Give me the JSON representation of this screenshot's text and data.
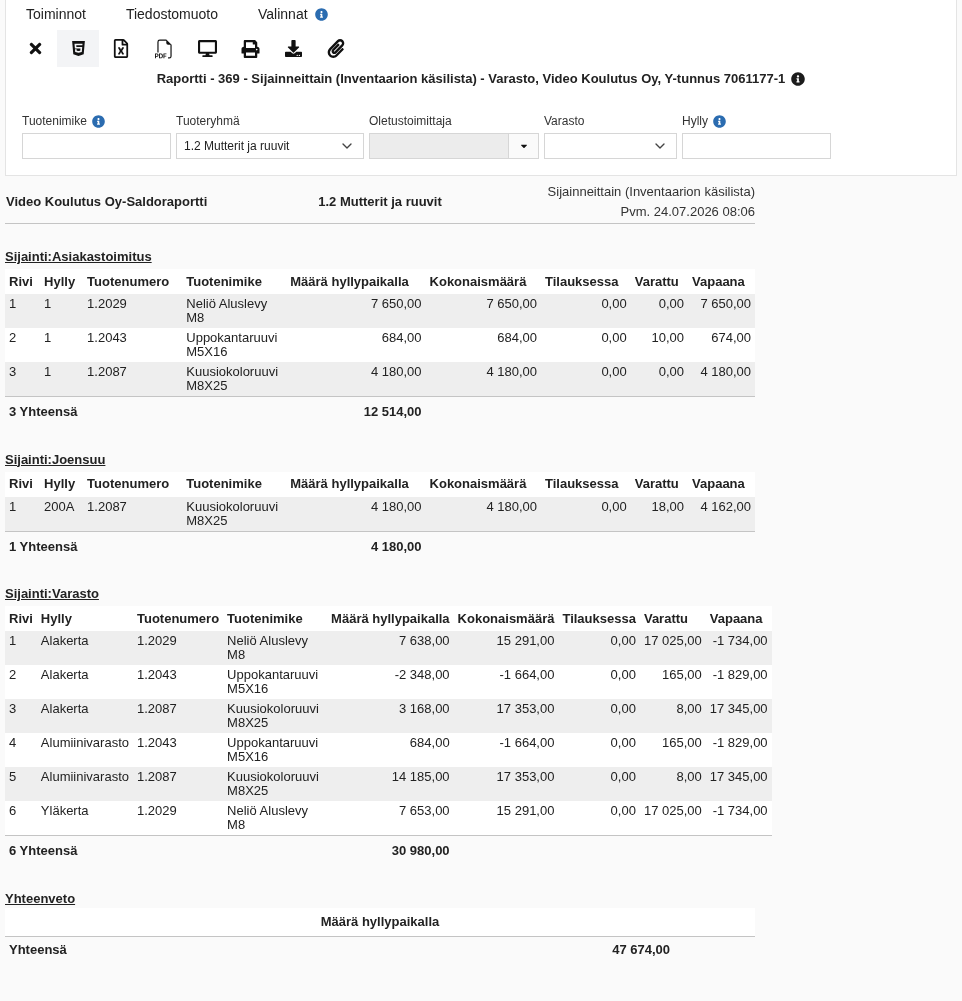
{
  "menu": [
    {
      "label": "Toiminnot",
      "info": false
    },
    {
      "label": "Tiedostomuoto",
      "info": false
    },
    {
      "label": "Valinnat",
      "info": true
    }
  ],
  "toolbar": [
    {
      "kind": "close",
      "selected": false
    },
    {
      "kind": "html",
      "selected": true
    },
    {
      "kind": "excel",
      "selected": false
    },
    {
      "kind": "pdf",
      "selected": false
    },
    {
      "kind": "screen",
      "selected": false
    },
    {
      "kind": "print",
      "selected": false
    },
    {
      "kind": "download",
      "selected": false
    },
    {
      "kind": "attach",
      "selected": false
    }
  ],
  "title": {
    "text": "Raportti - 369 - Sijainneittain (Inventaarion käsilista) - Varasto, Video Koulutus Oy, Y-tunnus 7061177-1",
    "info": true
  },
  "filters": [
    {
      "label": "Tuotenimike",
      "info": true,
      "kind": "text",
      "disabled": false
    },
    {
      "label": "Tuoteryhmä",
      "info": false,
      "kind": "select",
      "value": "1.2 Mutterit ja ruuvit",
      "disabled": false
    },
    {
      "label": "Oletustoimittaja",
      "info": false,
      "kind": "combo",
      "disabled": true
    },
    {
      "label": "Varasto",
      "info": false,
      "kind": "select",
      "disabled": false
    },
    {
      "label": "Hylly",
      "info": true,
      "kind": "text",
      "disabled": false
    }
  ],
  "report_header": {
    "company_title": "Video Koulutus Oy-Saldoraportti",
    "group": "1.2 Mutterit ja ruuvit",
    "report_type": "Sijainneittain (Inventaarion käsilista)",
    "date": "Pvm. 24.07.2026 08:06"
  },
  "sections": [
    {
      "title": "Sijainti:Asiakastoimitus",
      "columns": [
        "Rivi",
        "Hylly",
        "Tuotenumero",
        "Tuotenimike",
        "Määrä hyllypaikalla",
        "Kokonaismäärä",
        "Tilauksessa",
        "Varattu",
        "Vapaana"
      ],
      "rows": [
        [
          "1",
          "1",
          "1.2029",
          "Neliö Aluslevy M8",
          "7 650,00",
          "7 650,00",
          "0,00",
          "0,00",
          "7 650,00"
        ],
        [
          "2",
          "1",
          "1.2043",
          "Uppokantaruuvi M5X16",
          "684,00",
          "684,00",
          "0,00",
          "10,00",
          "674,00"
        ],
        [
          "3",
          "1",
          "1.2087",
          "Kuusiokoloruuvi M8X25",
          "4 180,00",
          "4 180,00",
          "0,00",
          "0,00",
          "4 180,00"
        ]
      ],
      "total": {
        "label": "3 Yhteensä",
        "value": "12 514,00"
      }
    },
    {
      "title": "Sijainti:Joensuu",
      "columns": [
        "Rivi",
        "Hylly",
        "Tuotenumero",
        "Tuotenimike",
        "Määrä hyllypaikalla",
        "Kokonaismäärä",
        "Tilauksessa",
        "Varattu",
        "Vapaana"
      ],
      "rows": [
        [
          "1",
          "200A",
          "1.2087",
          "Kuusiokoloruuvi M8X25",
          "4 180,00",
          "4 180,00",
          "0,00",
          "18,00",
          "4 162,00"
        ]
      ],
      "total": {
        "label": "1 Yhteensä",
        "value": "4 180,00"
      }
    },
    {
      "title": "Sijainti:Varasto",
      "columns": [
        "Rivi",
        "Hylly",
        "Tuotenumero",
        "Tuotenimike",
        "Määrä hyllypaikalla",
        "Kokonaismäärä",
        "Tilauksessa",
        "Varattu",
        "Vapaana"
      ],
      "rows": [
        [
          "1",
          "Alakerta",
          "1.2029",
          "Neliö Aluslevy M8",
          "7 638,00",
          "15 291,00",
          "0,00",
          "17 025,00",
          "-1 734,00"
        ],
        [
          "2",
          "Alakerta",
          "1.2043",
          "Uppokantaruuvi M5X16",
          "-2 348,00",
          "-1 664,00",
          "0,00",
          "165,00",
          "-1 829,00"
        ],
        [
          "3",
          "Alakerta",
          "1.2087",
          "Kuusiokoloruuvi M8X25",
          "3 168,00",
          "17 353,00",
          "0,00",
          "8,00",
          "17 345,00"
        ],
        [
          "4",
          "Alumiinivarasto",
          "1.2043",
          "Uppokantaruuvi M5X16",
          "684,00",
          "-1 664,00",
          "0,00",
          "165,00",
          "-1 829,00"
        ],
        [
          "5",
          "Alumiinivarasto",
          "1.2087",
          "Kuusiokoloruuvi M8X25",
          "14 185,00",
          "17 353,00",
          "0,00",
          "8,00",
          "17 345,00"
        ],
        [
          "6",
          "Yläkerta",
          "1.2029",
          "Neliö Aluslevy M8",
          "7 653,00",
          "15 291,00",
          "0,00",
          "17 025,00",
          "-1 734,00"
        ]
      ],
      "total": {
        "label": "6 Yhteensä",
        "value": "30 980,00"
      }
    }
  ],
  "summary": {
    "title": "Yhteenveto",
    "column": "Määrä hyllypaikalla",
    "label": "Yhteensä",
    "value": "47 674,00"
  }
}
